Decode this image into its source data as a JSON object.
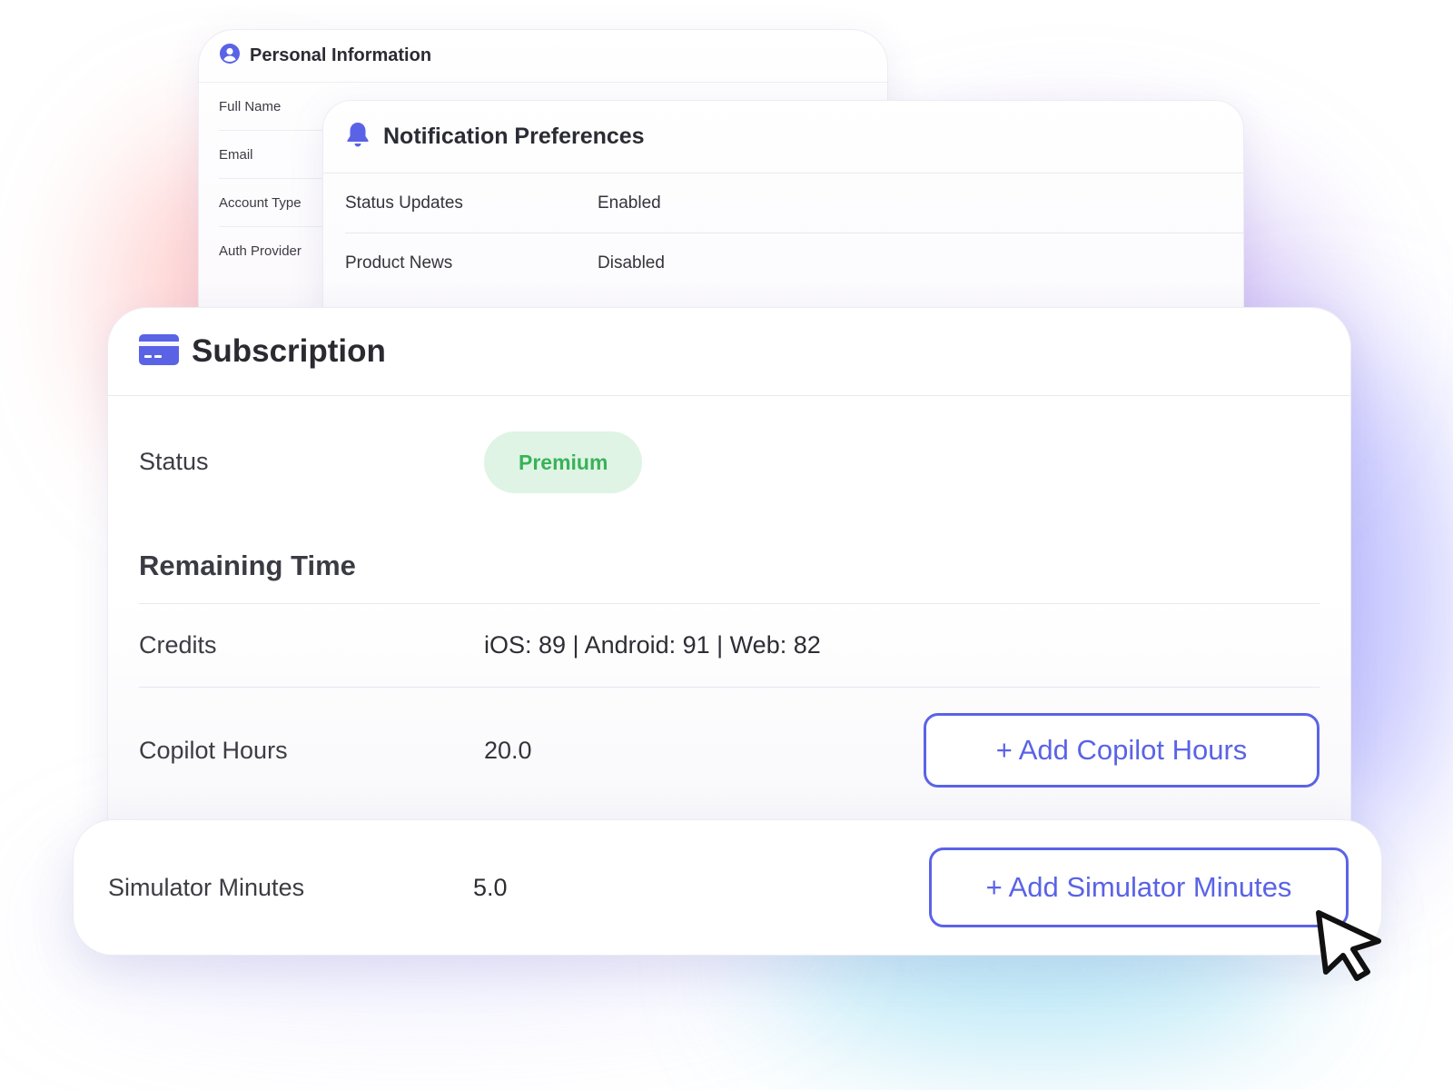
{
  "personal_card": {
    "title": "Personal Information",
    "icon": "user-circle-icon",
    "rows": [
      "Full Name",
      "Email",
      "Account Type",
      "Auth Provider"
    ]
  },
  "notification_card": {
    "title": "Notification Preferences",
    "icon": "bell-icon",
    "rows": [
      {
        "label": "Status Updates",
        "value": "Enabled"
      },
      {
        "label": "Product News",
        "value": "Disabled"
      }
    ]
  },
  "subscription_card": {
    "title": "Subscription",
    "icon": "credit-card-icon",
    "status_label": "Status",
    "status_value": "Premium",
    "section_title": "Remaining Time",
    "credits_label": "Credits",
    "credits_value": "iOS: 89 | Android: 91 | Web: 82",
    "copilot_label": "Copilot Hours",
    "copilot_value": "20.0",
    "copilot_button": "+ Add Copilot Hours"
  },
  "simulator_bar": {
    "label": "Simulator Minutes",
    "value": "5.0",
    "button": "+ Add Simulator Minutes"
  },
  "colors": {
    "accent": "#5a63e6",
    "badge_bg": "#dff4e4",
    "badge_text": "#39b25a"
  },
  "cursor": "pointer-arrow-icon"
}
